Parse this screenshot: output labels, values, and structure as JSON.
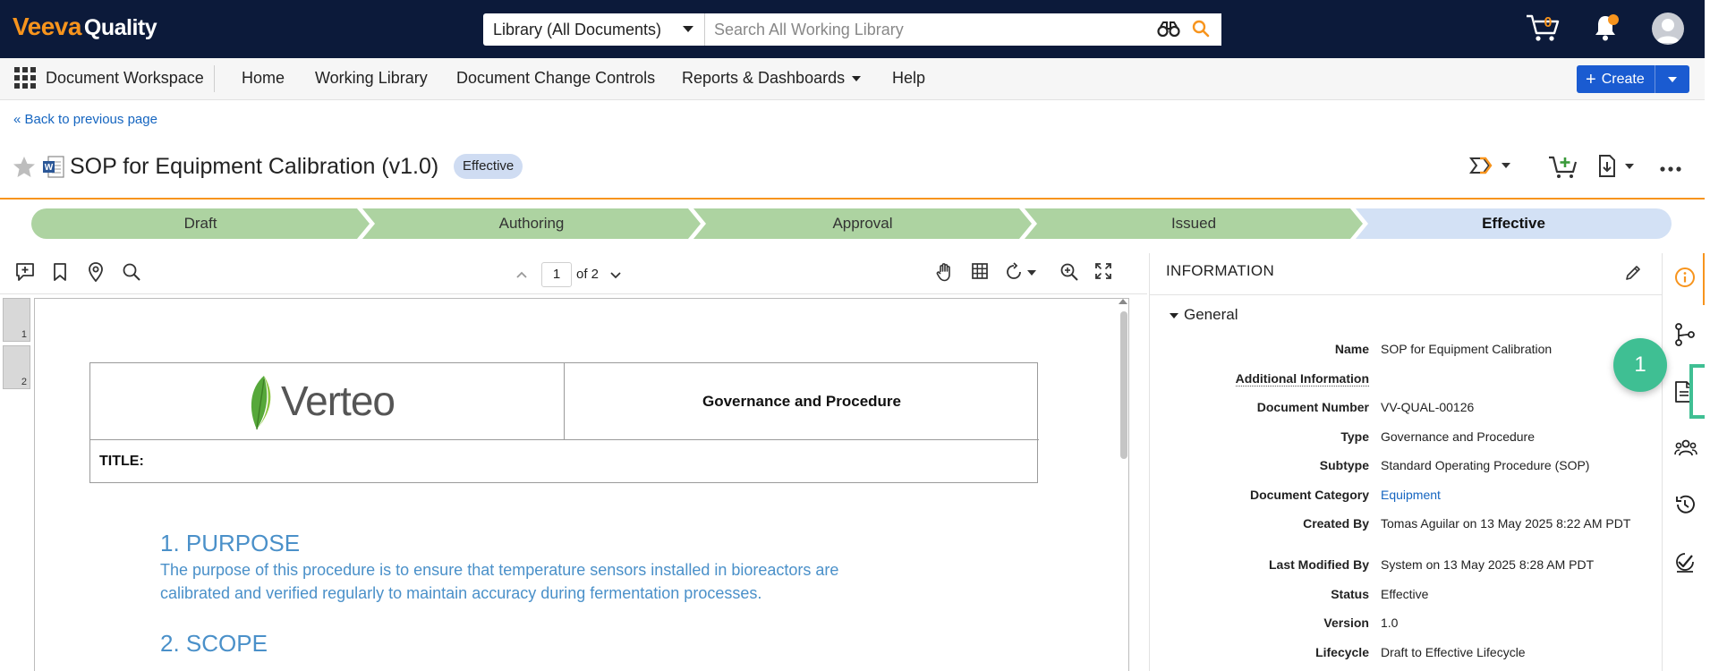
{
  "header": {
    "logo_brand": "Veeva",
    "logo_product": "Quality",
    "search_scope": "Library (All Documents)",
    "search_placeholder": "Search All Working Library",
    "cart_count": "0"
  },
  "nav": {
    "workspace": "Document Workspace",
    "items": [
      "Home",
      "Working Library",
      "Document Change Controls",
      "Reports & Dashboards",
      "Help"
    ],
    "create_label": "Create"
  },
  "back_link": "« Back to previous page",
  "document": {
    "title": "SOP for Equipment Calibration (v1.0)",
    "status": "Effective"
  },
  "lifecycle": {
    "stages": [
      "Draft",
      "Authoring",
      "Approval",
      "Issued",
      "Effective"
    ],
    "current": "Effective"
  },
  "viewer": {
    "page_current": "1",
    "page_total_label": "of 2",
    "thumb_labels": [
      "1",
      "2"
    ]
  },
  "doc_content": {
    "company": "Verteo",
    "governance": "Governance and Procedure",
    "title_label": "TITLE:",
    "section1_heading": "1. PURPOSE",
    "section1_line1": "The purpose of this procedure is to ensure that temperature sensors installed in bioreactors are",
    "section1_line2": "calibrated and verified regularly to maintain accuracy during fermentation processes.",
    "section2_heading": "2. SCOPE"
  },
  "info_panel": {
    "heading": "INFORMATION",
    "section": "General",
    "fields": [
      {
        "label": "Name",
        "value": "SOP for Equipment Calibration"
      },
      {
        "label": "Additional Information",
        "value": ""
      },
      {
        "label": "Document Number",
        "value": "VV-QUAL-00126"
      },
      {
        "label": "Type",
        "value": "Governance and Procedure"
      },
      {
        "label": "Subtype",
        "value": "Standard Operating Procedure (SOP)"
      },
      {
        "label": "Document Category",
        "value": "Equipment"
      },
      {
        "label": "Created By",
        "value": "Tomas Aguilar on 13 May 2025 8:22 AM PDT"
      },
      {
        "label": "Last Modified By",
        "value": "System on 13 May 2025 8:28 AM PDT"
      },
      {
        "label": "Status",
        "value": "Effective"
      },
      {
        "label": "Version",
        "value": "1.0"
      },
      {
        "label": "Lifecycle",
        "value": "Draft to Effective Lifecycle"
      }
    ]
  },
  "callout_number": "1",
  "colors": {
    "topbar": "#0c1a3a",
    "accent_orange": "#f7941d",
    "primary_blue": "#1a5bd1",
    "stage_done": "#add3a1",
    "stage_current": "#d3e1f5",
    "callout_green": "#3fbf93"
  },
  "icons": {
    "toolbar_left": [
      "add-annotation-icon",
      "bookmark-icon",
      "location-pin-icon",
      "search-icon"
    ],
    "toolbar_right": [
      "hand-pan-icon",
      "grid-icon",
      "rotate-icon",
      "zoom-in-icon",
      "fullscreen-icon"
    ],
    "rail": [
      "info-icon",
      "relationships-icon",
      "document-icon",
      "sharing-icon",
      "history-icon",
      "tasks-check-icon"
    ]
  }
}
